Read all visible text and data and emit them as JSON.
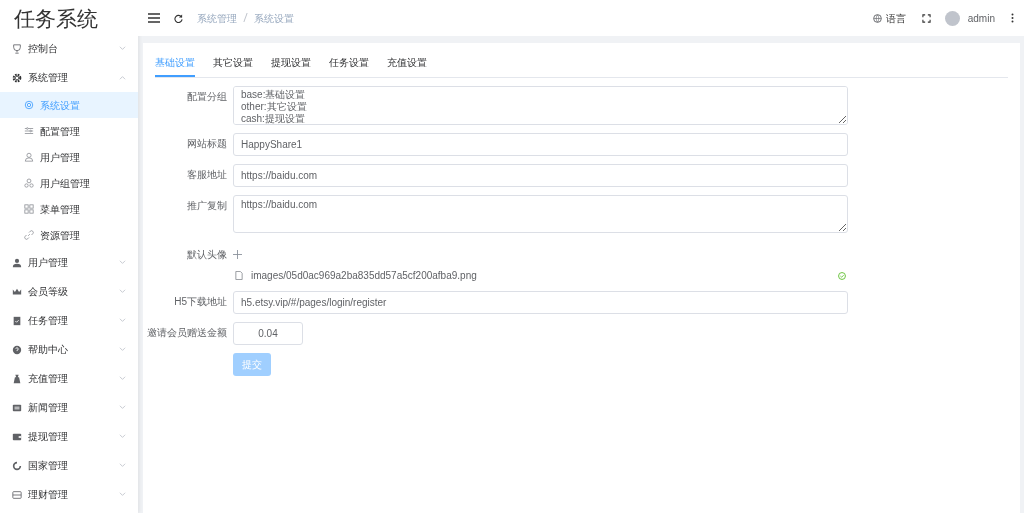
{
  "sidebar": {
    "logo": "任务系统",
    "items": [
      {
        "label": "控制台",
        "expanded": false
      },
      {
        "label": "系统管理",
        "expanded": true,
        "children": [
          {
            "label": "系统设置",
            "selected": true
          },
          {
            "label": "配置管理",
            "selected": false
          },
          {
            "label": "用户管理",
            "selected": false
          },
          {
            "label": "用户组管理",
            "selected": false
          },
          {
            "label": "菜单管理",
            "selected": false
          },
          {
            "label": "资源管理",
            "selected": false
          }
        ]
      },
      {
        "label": "用户管理",
        "expanded": false
      },
      {
        "label": "会员等级",
        "expanded": false
      },
      {
        "label": "任务管理",
        "expanded": false
      },
      {
        "label": "帮助中心",
        "expanded": false
      },
      {
        "label": "充值管理",
        "expanded": false
      },
      {
        "label": "新闻管理",
        "expanded": false
      },
      {
        "label": "提现管理",
        "expanded": false
      },
      {
        "label": "国家管理",
        "expanded": false
      },
      {
        "label": "理财管理",
        "expanded": false
      }
    ]
  },
  "header": {
    "breadcrumb": [
      "系统管理",
      "系统设置"
    ],
    "language": "语言",
    "user": "admin"
  },
  "tabs": [
    {
      "label": "基础设置",
      "selected": true
    },
    {
      "label": "其它设置",
      "selected": false
    },
    {
      "label": "提现设置",
      "selected": false
    },
    {
      "label": "任务设置",
      "selected": false
    },
    {
      "label": "充值设置",
      "selected": false
    }
  ],
  "form": [
    {
      "kind": "textarea",
      "label": "配置分组",
      "lines": [
        "base:基础设置",
        "other:其它设置",
        "cash:提现设置"
      ]
    },
    {
      "kind": "input",
      "label": "网站标题",
      "value": "HappyShare1"
    },
    {
      "kind": "input",
      "label": "客服地址",
      "value": "https://baidu.com"
    },
    {
      "kind": "textarea",
      "label": "推广复制",
      "lines": [
        "https://baidu.com"
      ]
    },
    {
      "kind": "upload",
      "label": "默认头像",
      "file": "images/05d0ac969a2ba835dd57a5cf200afba9.png"
    },
    {
      "kind": "input",
      "label": "H5下载地址",
      "value": "h5.etsy.vip/#/pages/login/register"
    },
    {
      "kind": "number",
      "label": "邀请会员赠送金额",
      "value": "0.04"
    }
  ],
  "submit": {
    "label": "提交",
    "disabled": true
  }
}
